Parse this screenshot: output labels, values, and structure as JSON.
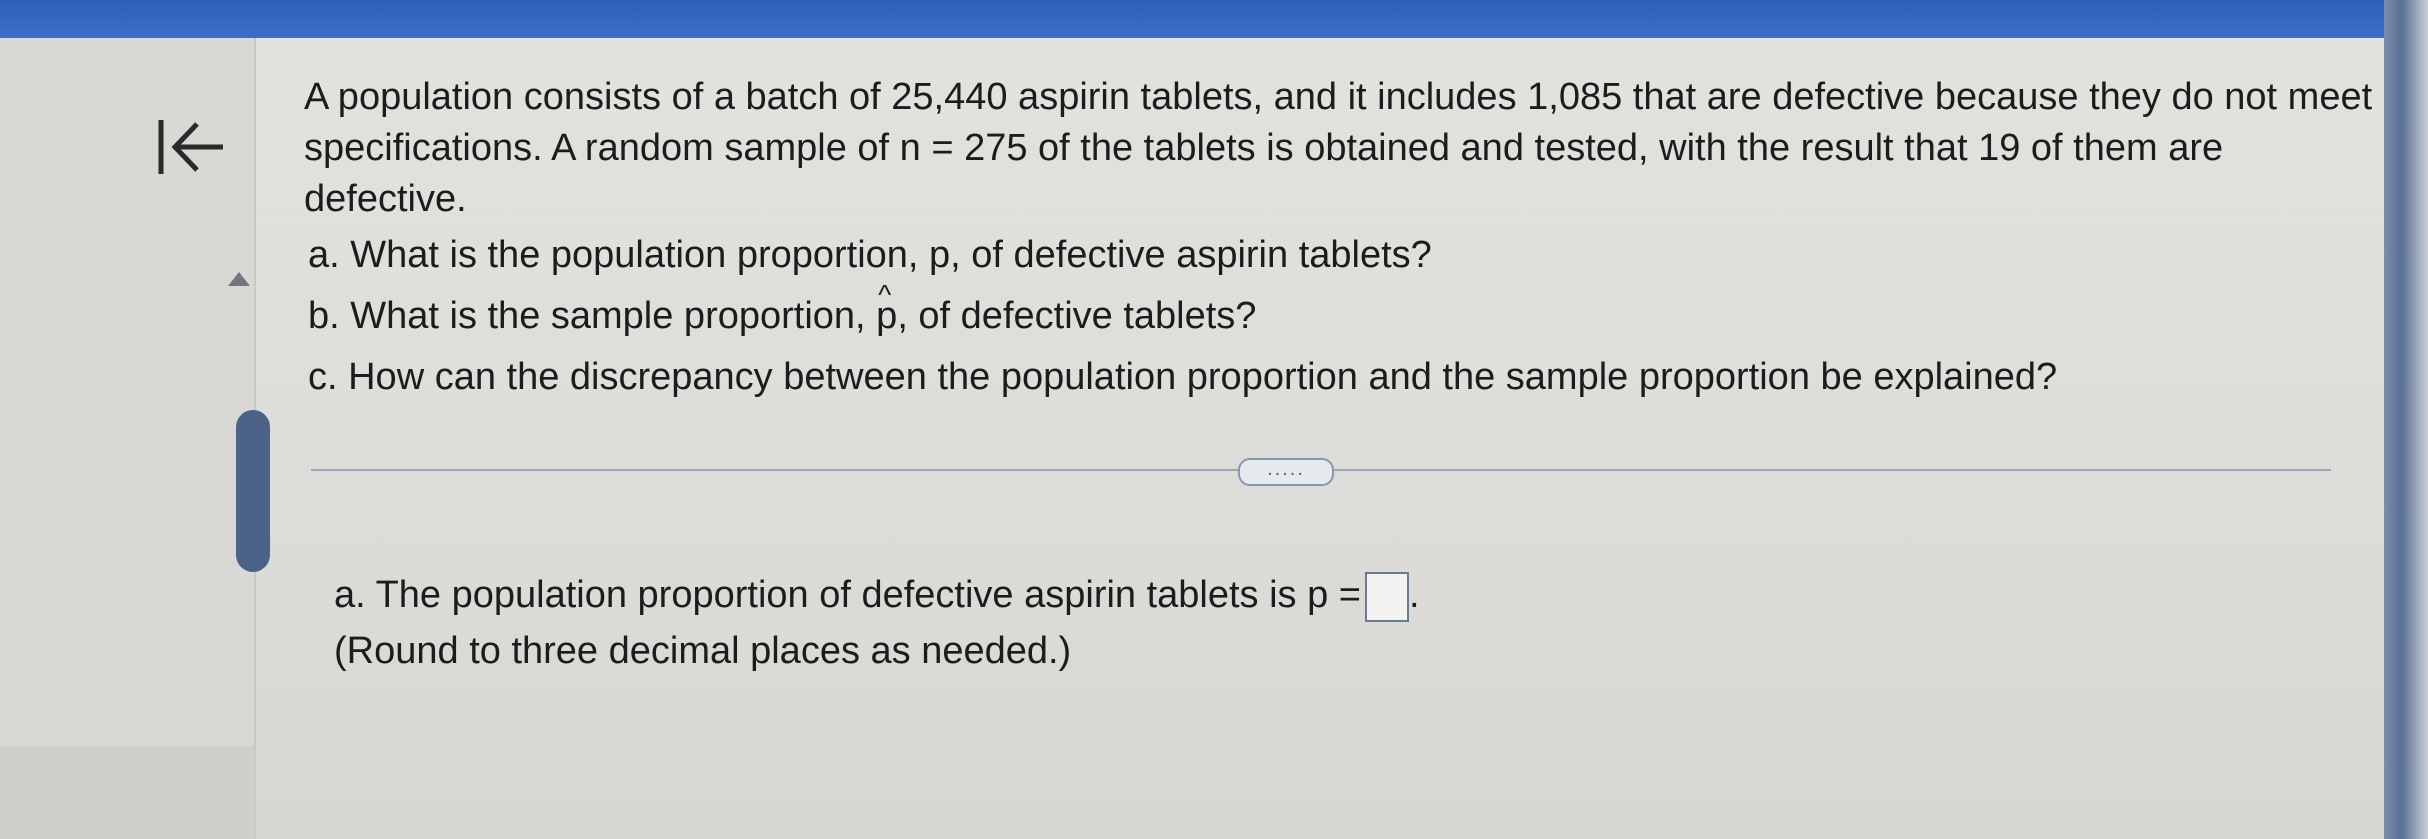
{
  "header": {
    "color": "#2d5fb8"
  },
  "nav": {
    "back_icon": "first-page-arrow-icon"
  },
  "question": {
    "intro": "A population consists of a batch of 25,440 aspirin tablets, and it includes 1,085 that are defective because they do not meet specifications. A random sample of n = 275 of the tablets is obtained and tested, with the result that 19 of them are defective.",
    "part_a": "a. What is the population proportion, p, of defective aspirin tablets?",
    "part_b_prefix": "b. What is the sample proportion,",
    "part_b_symbol": "p",
    "part_b_suffix": ", of defective tablets?",
    "part_c": "c. How can the discrepancy between the population proportion and the sample proportion be explained?"
  },
  "more_button": {
    "label": "....."
  },
  "answer": {
    "line1": "a. The population proportion of defective aspirin tablets is p =",
    "input_value": "",
    "line1_end": ".",
    "hint": "(Round to three decimal places as needed.)"
  }
}
